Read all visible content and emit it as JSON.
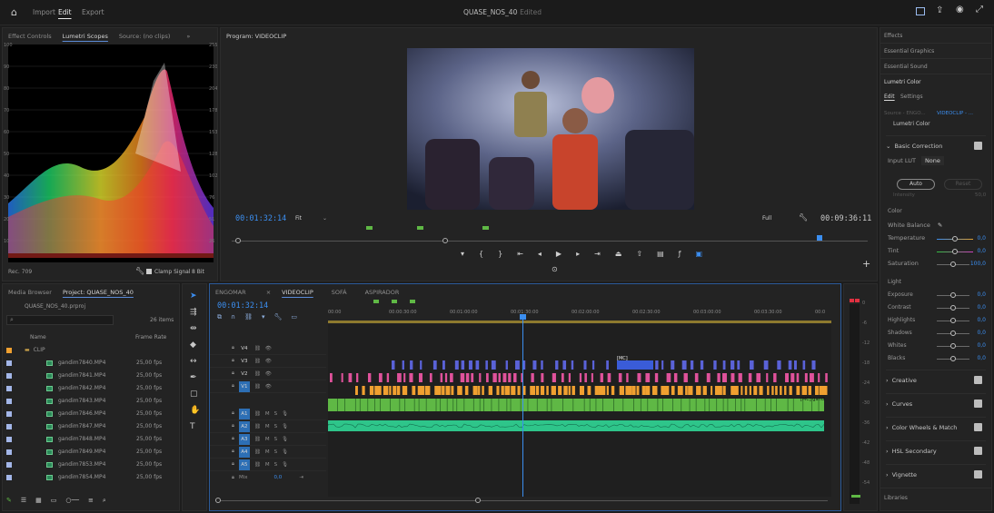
{
  "header": {
    "import": "Import",
    "edit": "Edit",
    "export": "Export",
    "title": "QUASE_NOS_40",
    "title_suffix": "- Edited"
  },
  "left_panel": {
    "tabs": [
      "Effect Controls",
      "Lumetri Scopes",
      "Source: (no clips)"
    ],
    "active_tab": "Lumetri Scopes",
    "y_ticks": [
      "100",
      "90",
      "80",
      "70",
      "60",
      "50",
      "40",
      "30",
      "20",
      "10"
    ],
    "r_ticks": [
      "255",
      "230",
      "204",
      "178",
      "153",
      "128",
      "102",
      "76",
      "51",
      "26"
    ],
    "footer_left": "Rec. 709",
    "clamp_label": "Clamp Signal",
    "bit_label": "8 Bit"
  },
  "program": {
    "title": "Program: VIDEOCLIP",
    "timecode": "00:01:32:14",
    "fit": "Fit",
    "full": "Full",
    "duration": "00:09:36:11"
  },
  "project": {
    "tabs": [
      "Media Browser",
      "Project: QUASE_NOS_40"
    ],
    "file": "QUASE_NOS_40.prproj",
    "items_count": "26 items",
    "col_name": "Name",
    "col_rate": "Frame Rate",
    "folder": "CLIP",
    "clips": [
      {
        "name": "gandim7840.MP4",
        "rate": "25,00 fps"
      },
      {
        "name": "gandim7841.MP4",
        "rate": "25,00 fps"
      },
      {
        "name": "gandim7842.MP4",
        "rate": "25,00 fps"
      },
      {
        "name": "gandim7843.MP4",
        "rate": "25,00 fps"
      },
      {
        "name": "gandim7846.MP4",
        "rate": "25,00 fps"
      },
      {
        "name": "gandim7847.MP4",
        "rate": "25,00 fps"
      },
      {
        "name": "gandim7848.MP4",
        "rate": "25,00 fps"
      },
      {
        "name": "gandim7849.MP4",
        "rate": "25,00 fps"
      },
      {
        "name": "gandim7853.MP4",
        "rate": "25,00 fps"
      },
      {
        "name": "gandim7854.MP4",
        "rate": "25,00 fps"
      }
    ]
  },
  "timeline": {
    "tabs": [
      "ENGOMAR",
      "VIDEOCLIP",
      "SOFÁ",
      "ASPIRADOR"
    ],
    "active_tab": "VIDEOCLIP",
    "timecode": "00:01:32:14",
    "ruler": [
      "00:00",
      "00:00:30:00",
      "00:01:00:00",
      "00:01:30:00",
      "00:02:00:00",
      "00:02:30:00",
      "00:03:00:00",
      "00:03:30:00",
      "00:0"
    ],
    "video_tracks": [
      "V4",
      "V3",
      "V2",
      "V1"
    ],
    "audio_tracks": [
      "A1",
      "A2",
      "A3",
      "A4",
      "A5"
    ],
    "mix_label": "Mix",
    "mix_value": "0,0",
    "clip_label_v3": "[MC]",
    "clip_label_v1": "[MC] gandi",
    "meter_ticks": [
      "0",
      "-6",
      "-12",
      "-18",
      "-24",
      "-30",
      "-36",
      "-42",
      "-48",
      "-54"
    ]
  },
  "right_panel": {
    "sections": [
      "Effects",
      "Essential Graphics",
      "Essential Sound",
      "Lumetri Color"
    ],
    "subtabs": [
      "Edit",
      "Settings"
    ],
    "source": "Source - ENGO...",
    "seq": "VIDEOCLIP - ...",
    "fx": "Lumetri Color",
    "basic_correction": "Basic Correction",
    "input_lut": "Input LUT",
    "lut_value": "None",
    "auto": "Auto",
    "reset": "Reset",
    "intensity": "Intensity",
    "intensity_val": "50,0",
    "color": "Color",
    "white_balance": "White Balance",
    "temperature": "Temperature",
    "temperature_val": "0,0",
    "tint": "Tint",
    "tint_val": "0,0",
    "saturation": "Saturation",
    "saturation_val": "100,0",
    "light": "Light",
    "light_params": [
      {
        "name": "Exposure",
        "val": "0,0"
      },
      {
        "name": "Contrast",
        "val": "0,0"
      },
      {
        "name": "Highlights",
        "val": "0,0"
      },
      {
        "name": "Shadows",
        "val": "0,0"
      },
      {
        "name": "Whites",
        "val": "0,0"
      },
      {
        "name": "Blacks",
        "val": "0,0"
      }
    ],
    "collapsed": [
      "Creative",
      "Curves",
      "Color Wheels & Match",
      "HSL Secondary",
      "Vignette"
    ],
    "libraries": "Libraries"
  },
  "colors": {
    "accent": "#3b8ef0",
    "pink": "#e0529b",
    "orange": "#f0a030",
    "green": "#5fb845",
    "audio": "#2ec58a"
  }
}
